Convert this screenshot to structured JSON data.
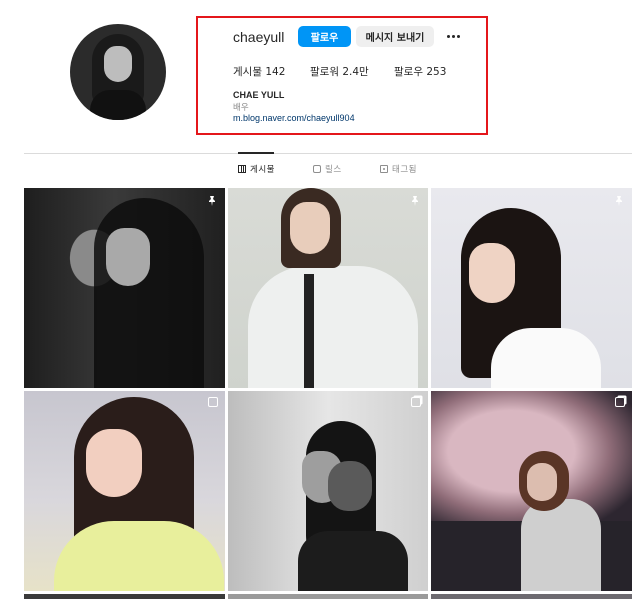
{
  "profile": {
    "username": "chaeyull",
    "follow_label": "팔로우",
    "message_label": "메시지 보내기",
    "stats": {
      "posts_label": "게시물",
      "posts_count": "142",
      "followers_label": "팔로워",
      "followers_count": "2.4만",
      "following_label": "팔로우",
      "following_count": "253"
    },
    "full_name": "CHAE YULL",
    "category": "배우",
    "link": "m.blog.naver.com/chaeyull904"
  },
  "tabs": [
    {
      "label": "게시물",
      "icon": "grid-icon",
      "active": true
    },
    {
      "label": "릴스",
      "icon": "reels-icon",
      "active": false
    },
    {
      "label": "태그됨",
      "icon": "tagged-icon",
      "active": false
    }
  ],
  "posts": [
    {
      "badge": "pin-icon"
    },
    {
      "badge": "pin-icon"
    },
    {
      "badge": "pin-icon"
    },
    {
      "badge": "reel-icon"
    },
    {
      "badge": "carousel-icon"
    },
    {
      "badge": "carousel-icon"
    }
  ],
  "colors": {
    "accent": "#0095f6",
    "highlight": "#e4161b",
    "link": "#00376b"
  }
}
